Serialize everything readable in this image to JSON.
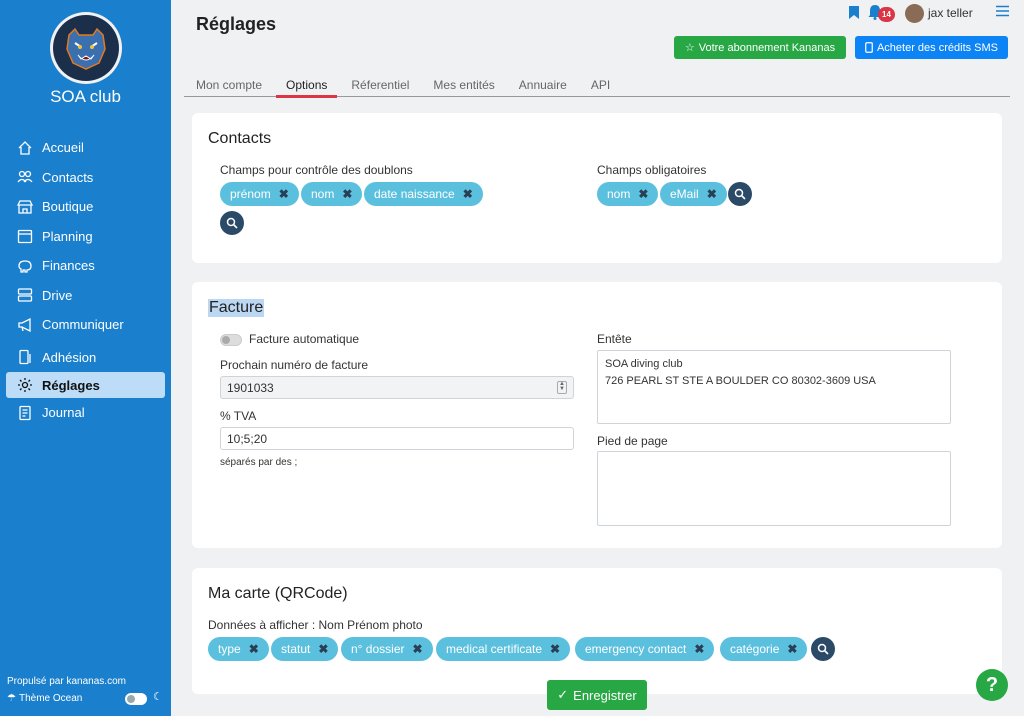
{
  "club": {
    "name": "SOA club"
  },
  "sidebar": {
    "items": [
      {
        "label": "Accueil",
        "icon": "home-icon"
      },
      {
        "label": "Contacts",
        "icon": "users-icon"
      },
      {
        "label": "Boutique",
        "icon": "shop-icon"
      },
      {
        "label": "Planning",
        "icon": "calendar-icon"
      },
      {
        "label": "Finances",
        "icon": "piggy-bank-icon"
      },
      {
        "label": "Drive",
        "icon": "drive-icon"
      },
      {
        "label": "Communiquer",
        "icon": "megaphone-icon"
      },
      {
        "label": "Adhésion",
        "icon": "membership-icon"
      },
      {
        "label": "Réglages",
        "icon": "gear-icon"
      },
      {
        "label": "Journal",
        "icon": "journal-icon"
      }
    ],
    "powered_by": "Propulsé par kananas.com",
    "theme_label": "Thème Ocean"
  },
  "header": {
    "title": "Réglages",
    "notifications_count": "14",
    "username": "jax teller",
    "subscription_button": "Votre abonnement Kananas",
    "sms_button": "Acheter des crédits SMS"
  },
  "tabs": [
    {
      "label": "Mon compte"
    },
    {
      "label": "Options"
    },
    {
      "label": "Réferentiel"
    },
    {
      "label": "Mes entités"
    },
    {
      "label": "Annuaire"
    },
    {
      "label": "API"
    }
  ],
  "contacts": {
    "title": "Contacts",
    "duplicates_label": "Champs pour contrôle des doublons",
    "duplicates_chips": [
      "prénom",
      "nom",
      "date naissance"
    ],
    "required_label": "Champs obligatoires",
    "required_chips": [
      "nom",
      "eMail"
    ]
  },
  "facture": {
    "title": "Facture",
    "auto_label": "Facture automatique",
    "next_number_label": "Prochain numéro de facture",
    "next_number_value": "1901033",
    "tva_label": "% TVA",
    "tva_value": "10;5;20",
    "tva_hint": "séparés par des ;",
    "header_label": "Entête",
    "header_value": "SOA diving club\n726 PEARL ST STE A BOULDER CO 80302-3609 USA",
    "footer_label": "Pied de page",
    "footer_value": ""
  },
  "carte": {
    "title": "Ma carte (QRCode)",
    "display_label": "Données à afficher : Nom Prénom photo",
    "chips": [
      "type",
      "statut",
      "n° dossier",
      "medical certificate",
      "emergency contact",
      "catégorie"
    ]
  },
  "save_button": "Enregistrer",
  "help_button": "?"
}
